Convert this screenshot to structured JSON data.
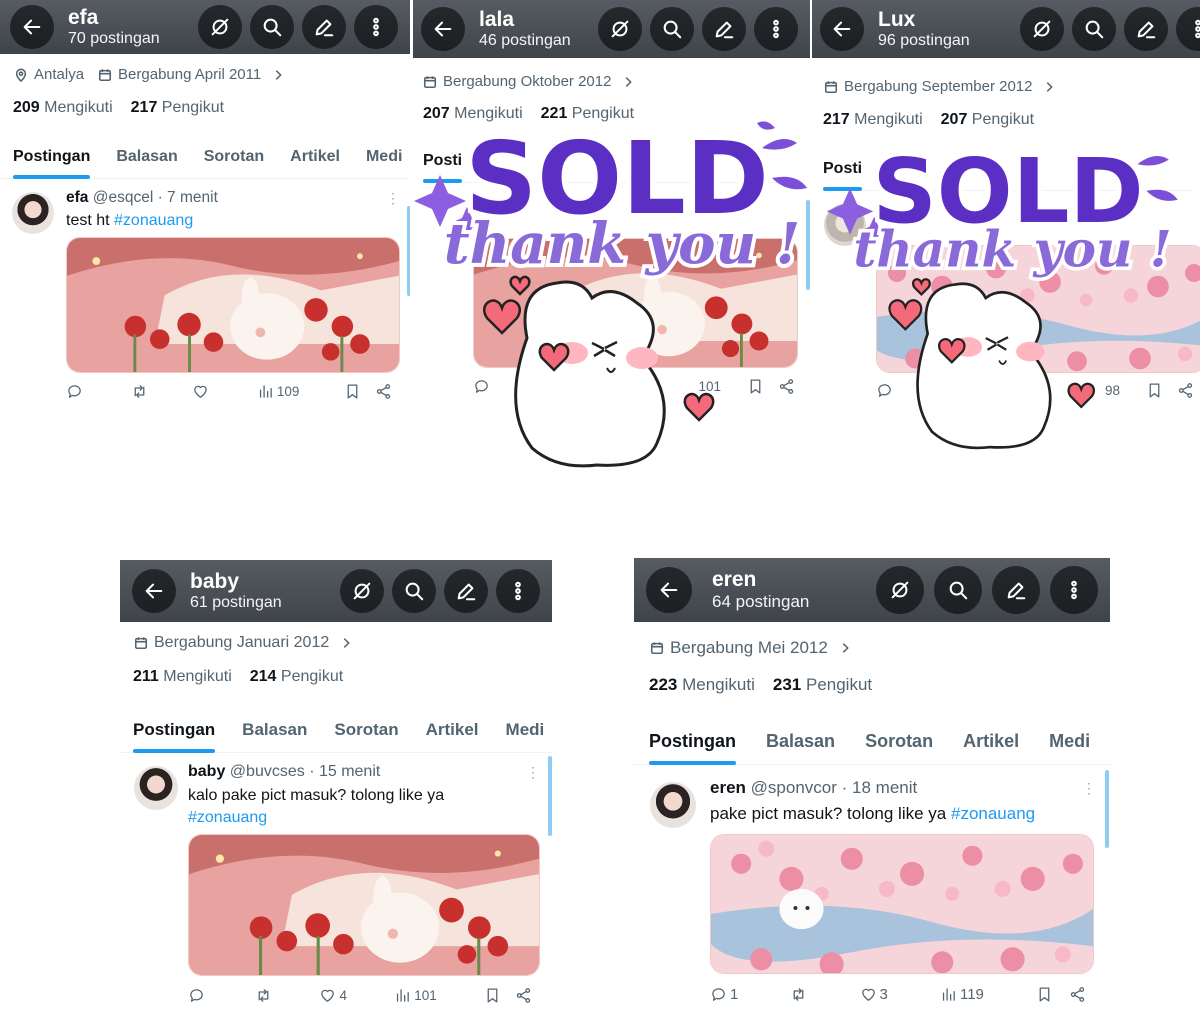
{
  "profiles": [
    {
      "name": "efa",
      "posts_count": "70 postingan",
      "location": "Antalya",
      "joined": "Bergabung April 2011",
      "following_num": "209",
      "following_label": "Mengikuti",
      "followers_num": "217",
      "followers_label": "Pengikut",
      "tabs": [
        "Postingan",
        "Balasan",
        "Sorotan",
        "Artikel",
        "Medi"
      ],
      "post": {
        "name": "efa",
        "handle": "@esqcel",
        "time": "· 7 menit",
        "text": "test ht",
        "hashtag": "#zonauang",
        "replies": "",
        "likes": "",
        "views": "109"
      }
    },
    {
      "name": "lala",
      "posts_count": "46 postingan",
      "joined": "Bergabung Oktober 2012",
      "following_num": "207",
      "following_label": "Mengikuti",
      "followers_num": "221",
      "followers_label": "Pengikut",
      "tabs": [
        "Posti"
      ],
      "post": {
        "views": "101"
      }
    },
    {
      "name": "Lux",
      "posts_count": "96 postingan",
      "joined": "Bergabung September 2012",
      "following_num": "217",
      "following_label": "Mengikuti",
      "followers_num": "207",
      "followers_label": "Pengikut",
      "tabs": [
        "Posti"
      ],
      "post": {
        "views": "98"
      }
    },
    {
      "name": "baby",
      "posts_count": "61 postingan",
      "joined": "Bergabung Januari 2012",
      "following_num": "211",
      "following_label": "Mengikuti",
      "followers_num": "214",
      "followers_label": "Pengikut",
      "tabs": [
        "Postingan",
        "Balasan",
        "Sorotan",
        "Artikel",
        "Medi"
      ],
      "post": {
        "name": "baby",
        "handle": "@buvcses",
        "time": "· 15 menit",
        "text": "kalo pake pict masuk? tolong like ya",
        "hashtag": "#zonauang",
        "replies": "",
        "likes": "4",
        "views": "101"
      }
    },
    {
      "name": "eren",
      "posts_count": "64 postingan",
      "joined": "Bergabung Mei 2012",
      "following_num": "223",
      "following_label": "Mengikuti",
      "followers_num": "231",
      "followers_label": "Pengikut",
      "tabs": [
        "Postingan",
        "Balasan",
        "Sorotan",
        "Artikel",
        "Medi"
      ],
      "post": {
        "name": "eren",
        "handle": "@sponvcor",
        "time": "· 18 menit",
        "text": "pake pict masuk? tolong like ya",
        "hashtag": "#zonauang",
        "replies": "1",
        "likes": "3",
        "views": "119"
      }
    }
  ],
  "sticker": {
    "line1": "SOLD",
    "line2": "thank you !"
  },
  "colors": {
    "accent": "#1d9bf0",
    "sticker_purple": "#6a3fd0",
    "header": "#4a5055"
  },
  "icons": [
    "back-arrow-icon",
    "hide-icon",
    "search-icon",
    "edit-icon",
    "more-icon",
    "location-icon",
    "calendar-icon",
    "chevron-right-icon",
    "reply-icon",
    "repost-icon",
    "like-icon",
    "views-icon",
    "bookmark-icon",
    "share-icon"
  ]
}
